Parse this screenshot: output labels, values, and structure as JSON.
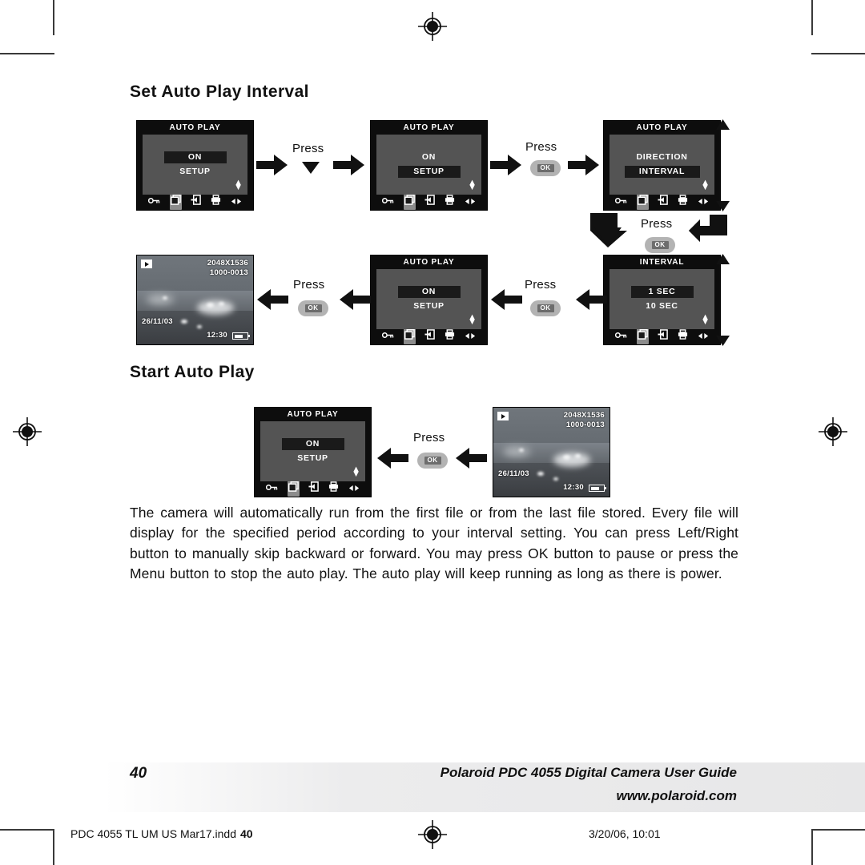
{
  "document": {
    "headings": {
      "set_interval": "Set Auto Play Interval",
      "start_autoplay": "Start Auto Play"
    },
    "body_paragraph": "The camera will automatically run from the first file or from the last file stored. Every file will display for the specified period according to your interval setting. You can press Left/Right button to manually skip backward or forward. You may press OK button to pause or press the Menu button to stop the auto play. The auto play will keep running as long as there is power.",
    "footer": {
      "page_number": "40",
      "title": "Polaroid PDC 4055 Digital Camera User Guide",
      "url": "www.polaroid.com"
    },
    "slug": {
      "left": "PDC 4055 TL UM US Mar17.indd",
      "page": "40",
      "right": "3/20/06, 10:01"
    }
  },
  "labels": {
    "press": "Press",
    "ok": "OK"
  },
  "screens": {
    "autoplay_on": {
      "title": "AUTO PLAY",
      "options": [
        "ON",
        "SETUP"
      ],
      "selected": "ON"
    },
    "autoplay_setup": {
      "title": "AUTO PLAY",
      "options": [
        "ON",
        "SETUP"
      ],
      "selected": "SETUP"
    },
    "autoplay_submenu": {
      "title": "AUTO PLAY",
      "options": [
        "DIRECTION",
        "INTERVAL"
      ],
      "selected": "INTERVAL"
    },
    "interval": {
      "title": "INTERVAL",
      "options": [
        "1 SEC",
        "10 SEC"
      ],
      "selected": "1 SEC"
    },
    "autoplay_start": {
      "title": "AUTO PLAY",
      "options": [
        "ON",
        "SETUP"
      ],
      "selected": "ON"
    }
  },
  "photo": {
    "resolution": "2048X1536",
    "file_number": "1000-0013",
    "date": "26/11/03",
    "time": "12:30"
  },
  "iconbar": {
    "icons": [
      "key-icon",
      "copy-pages-icon",
      "transfer-icon",
      "printer-icon",
      "left-right-arrows-icon"
    ],
    "selected_index": 1
  },
  "colors": {
    "screen_bezel": "#0d0d0d",
    "screen_body": "#545454",
    "highlight": "#1a1a1a",
    "ok_button": "#b3b3b3",
    "arrow": "#111111"
  }
}
